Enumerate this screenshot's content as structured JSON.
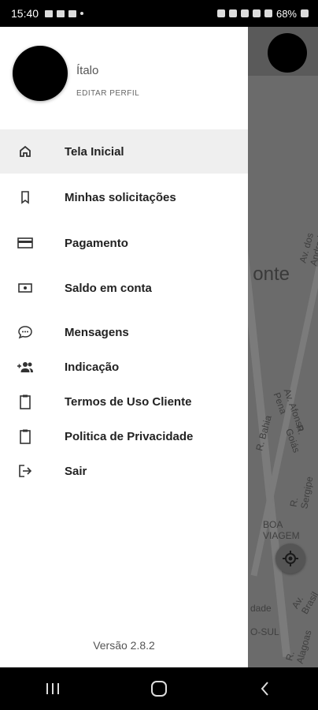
{
  "status_bar": {
    "time": "15:40",
    "battery": "68%"
  },
  "map": {
    "city_fragment": "onte",
    "labels": [
      "Av. dos Andradas",
      "Av. Afonso Pena",
      "R. Bahia",
      "R. Goiás",
      "R. Sergipe",
      "BOA VIAGEM",
      "dade",
      "O-SUL",
      "R. Alagoas",
      "Av. Brasil"
    ]
  },
  "profile": {
    "name": "Ítalo",
    "edit_label": "EDITAR PERFIL"
  },
  "menu": {
    "items": [
      {
        "label": "Tela Inicial",
        "icon": "home-icon"
      },
      {
        "label": "Minhas solicitações",
        "icon": "bookmark-icon"
      },
      {
        "label": "Pagamento",
        "icon": "credit-card-icon"
      },
      {
        "label": "Saldo em conta",
        "icon": "money-icon"
      },
      {
        "label": "Mensagens",
        "icon": "chat-bubble-icon"
      },
      {
        "label": "Indicação",
        "icon": "add-people-icon"
      },
      {
        "label": "Termos de Uso Cliente",
        "icon": "clipboard-icon"
      },
      {
        "label": "Politica de Privacidade",
        "icon": "clipboard-icon"
      },
      {
        "label": "Sair",
        "icon": "logout-icon"
      }
    ]
  },
  "version": "Versão 2.8.2"
}
